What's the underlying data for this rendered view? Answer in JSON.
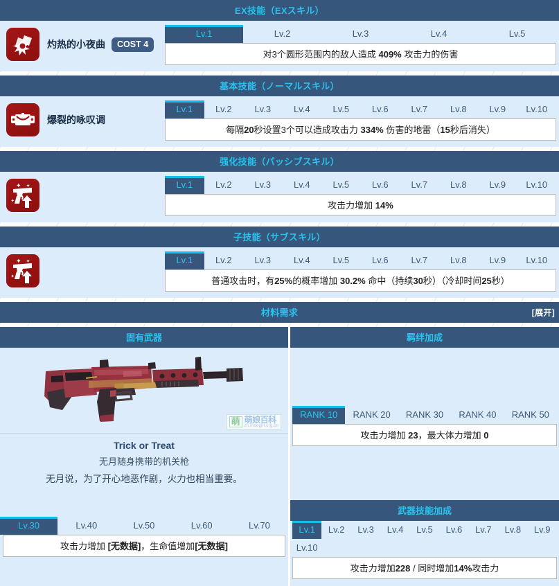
{
  "sections": [
    {
      "id": "ex-skill",
      "header": "EX技能（EXスキル）",
      "icon": "explosion-card-icon",
      "name": "灼热的小夜曲",
      "cost": "COST 4",
      "tabs": [
        "Lv.1",
        "Lv.2",
        "Lv.3",
        "Lv.4",
        "Lv.5"
      ],
      "active": 0,
      "desc_html": "对3个圆形范围内的敌人造成 <b>409%</b> 攻击力的伤害"
    },
    {
      "id": "normal-skill",
      "header": "基本技能（ノーマルスキル）",
      "icon": "mine-bomb-icon",
      "name": "爆裂的咏叹调",
      "cost": "",
      "tabs": [
        "Lv.1",
        "Lv.2",
        "Lv.3",
        "Lv.4",
        "Lv.5",
        "Lv.6",
        "Lv.7",
        "Lv.8",
        "Lv.9",
        "Lv.10"
      ],
      "active": 0,
      "desc_html": "每隔<b>20</b>秒设置3个可以造成攻击力 <b>334%</b> 伤害的地雷（<b>15</b>秒后消失）"
    },
    {
      "id": "passive-skill",
      "header": "强化技能（パッシブスキル）",
      "icon": "pistol-up-icon",
      "name": "",
      "cost": "",
      "tabs": [
        "Lv.1",
        "Lv.2",
        "Lv.3",
        "Lv.4",
        "Lv.5",
        "Lv.6",
        "Lv.7",
        "Lv.8",
        "Lv.9",
        "Lv.10"
      ],
      "active": 0,
      "desc_html": "攻击力增加 <b>14%</b>"
    },
    {
      "id": "sub-skill",
      "header": "子技能（サブスキル）",
      "icon": "pistol-up-icon",
      "name": "",
      "cost": "",
      "tabs": [
        "Lv.1",
        "Lv.2",
        "Lv.3",
        "Lv.4",
        "Lv.5",
        "Lv.6",
        "Lv.7",
        "Lv.8",
        "Lv.9",
        "Lv.10"
      ],
      "active": 0,
      "desc_html": "普通攻击时，有<b>25%</b>的概率增加 <b>30.2%</b> 命中（持续<b>30</b>秒）（冷却时间<b>25</b>秒）"
    }
  ],
  "materials": {
    "title": "材料需求",
    "expand_label": "[展开]"
  },
  "weapon": {
    "col_title": "固有武器",
    "name": "Trick or Treat",
    "subtitle": "无月随身携带的机关枪",
    "flavor": "无月说，为了开心地恶作剧，火力也相当重要。",
    "tabs": [
      "Lv.30",
      "Lv.40",
      "Lv.50",
      "Lv.60",
      "Lv.70"
    ],
    "active": 0,
    "desc_html": "攻击力增加 <b>[无数据]</b>，生命值增加<b>[无数据]</b>",
    "watermark": {
      "glyph": "萌",
      "main": "萌娘百科",
      "sub": "zh.moegirl.org.cn"
    }
  },
  "bond": {
    "col_title": "羁绊加成",
    "tabs": [
      "RANK 10",
      "RANK 20",
      "RANK 30",
      "RANK 40",
      "RANK 50"
    ],
    "active": 0,
    "desc_html": "攻击力增加 <b>23</b>，最大体力增加 <b>0</b>"
  },
  "weapon_skill": {
    "title": "武器技能加成",
    "tabs": [
      "Lv.1",
      "Lv.2",
      "Lv.3",
      "Lv.4",
      "Lv.5",
      "Lv.6",
      "Lv.7",
      "Lv.8",
      "Lv.9",
      "Lv.10"
    ],
    "active": 0,
    "desc_html": "攻击力增加<b>228</b> / 同时增加<b>14%</b>攻击力"
  },
  "colors": {
    "header_bg": "#36567c",
    "header_text": "#29c3ee",
    "body_bg": "#ddecfb",
    "tab_active_bg": "#36567c",
    "tab_active_text": "#2ec4f0",
    "tab_active_top": "#13bdec",
    "icon_red": "#a31616"
  }
}
